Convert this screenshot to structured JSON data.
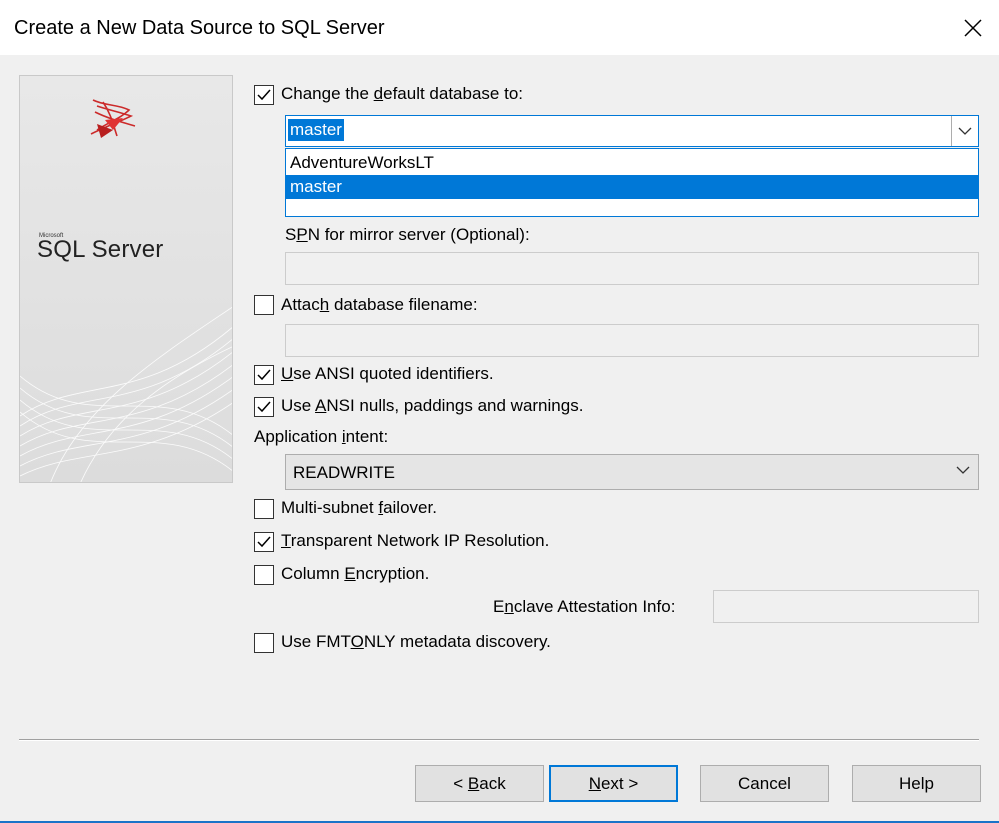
{
  "window": {
    "title": "Create a New Data Source to SQL Server"
  },
  "logo": {
    "vendor": "Microsoft",
    "product": "SQL Server"
  },
  "default_db": {
    "label_pre": "Change the ",
    "label_u": "d",
    "label_post": "efault database to:",
    "checked": true,
    "value": "master",
    "options": [
      "AdventureWorksLT",
      "master"
    ],
    "selected_option": "master"
  },
  "spn": {
    "label_pre": "S",
    "label_u": "P",
    "label_post": "N for mirror server (Optional):",
    "value": ""
  },
  "attach": {
    "label_pre": "Attac",
    "label_u": "h",
    "label_post": " database filename:",
    "checked": false,
    "value": ""
  },
  "ansi_quoted": {
    "label_pre": "",
    "label_u": "U",
    "label_post": "se ANSI quoted identifiers.",
    "checked": true
  },
  "ansi_nulls": {
    "label_pre": "Use ",
    "label_u": "A",
    "label_post": "NSI nulls, paddings and warnings.",
    "checked": true
  },
  "app_intent": {
    "label_pre": "Application ",
    "label_u": "i",
    "label_post": "ntent:",
    "value": "READWRITE"
  },
  "multi_subnet": {
    "label_pre": "Multi-subnet ",
    "label_u": "f",
    "label_post": "ailover.",
    "checked": false
  },
  "tnir": {
    "label_pre": "",
    "label_u": "T",
    "label_post": "ransparent Network IP Resolution.",
    "checked": true
  },
  "col_enc": {
    "label_pre": "Column ",
    "label_u": "E",
    "label_post": "ncryption.",
    "checked": false
  },
  "enclave": {
    "label_pre": "E",
    "label_u": "n",
    "label_post": "clave Attestation Info:",
    "value": ""
  },
  "fmtonly": {
    "label_pre": "Use FMT",
    "label_u": "O",
    "label_post": "NLY metadata discovery.",
    "checked": false
  },
  "buttons": {
    "back": {
      "pre": "< ",
      "u": "B",
      "post": "ack"
    },
    "next": {
      "pre": "",
      "u": "N",
      "post": "ext >"
    },
    "cancel": {
      "label": "Cancel"
    },
    "help": {
      "label": "Help"
    }
  },
  "icons": {
    "check": "checkmark-icon",
    "close": "close-icon",
    "chevron": "chevron-down-icon",
    "logo": "sql-server-logo-icon"
  }
}
